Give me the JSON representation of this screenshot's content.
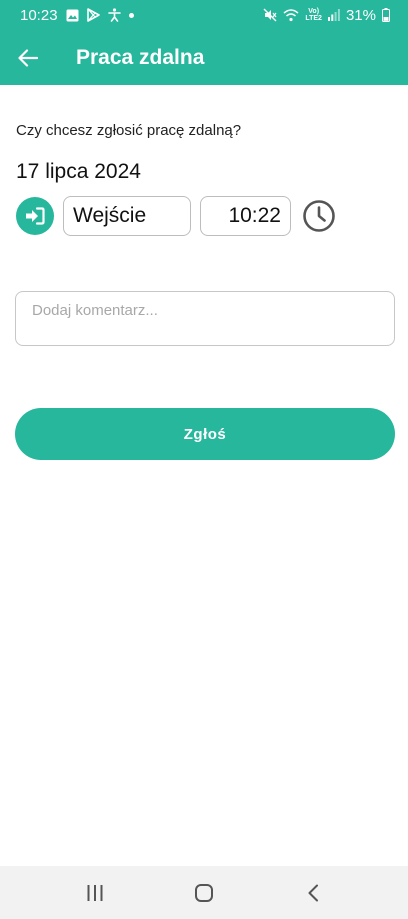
{
  "status_bar": {
    "time": "10:23",
    "battery": "31%",
    "network_top": "Vo)",
    "network_bottom": "LTE2",
    "icons": [
      "image-icon",
      "play-store-icon",
      "accessibility-icon",
      "dot-icon",
      "mute-icon",
      "wifi-icon",
      "signal-icon",
      "battery-icon"
    ]
  },
  "app_bar": {
    "title": "Praca zdalna",
    "back_icon": "arrow-left-icon"
  },
  "form": {
    "question": "Czy chcesz zgłosić pracę zdalną?",
    "date": "17 lipca 2024",
    "enter_icon": "sign-in-icon",
    "entry_type": "Wejście",
    "time": "10:22",
    "clock_icon": "clock-icon",
    "comment_placeholder": "Dodaj komentarz...",
    "comment_value": "",
    "submit_label": "Zgłoś"
  },
  "nav_bar": {
    "icons": [
      "recent-apps-icon",
      "home-icon",
      "back-icon"
    ]
  },
  "colors": {
    "accent": "#26b79d",
    "text": "#111111",
    "placeholder": "#a8a8a8",
    "border": "#bdbdbd",
    "nav_background": "#f2f2f2"
  }
}
